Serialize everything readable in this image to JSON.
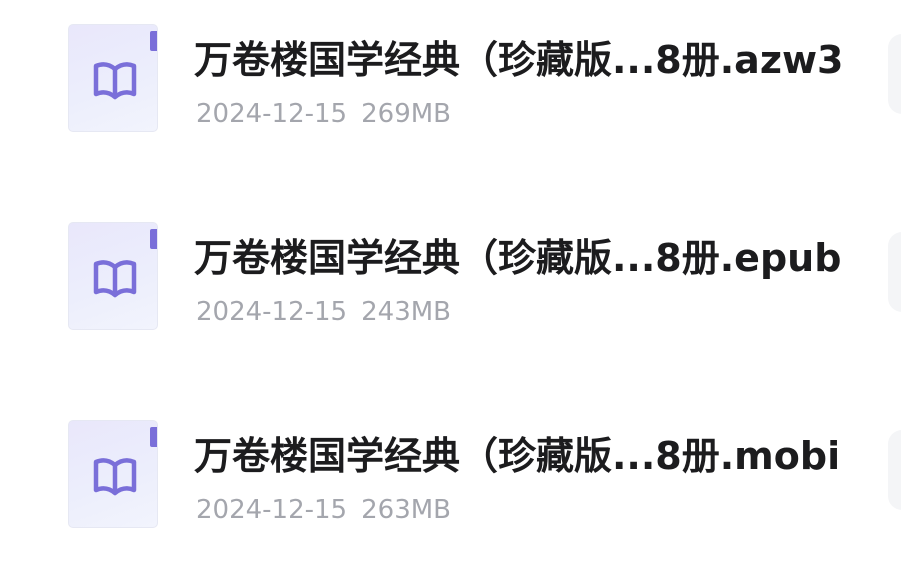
{
  "files": [
    {
      "name": "万卷楼国学经典（珍藏版...8册.azw3",
      "date": "2024-12-15",
      "size": "269MB",
      "icon": "ebook-icon"
    },
    {
      "name": "万卷楼国学经典（珍藏版...8册.epub",
      "date": "2024-12-15",
      "size": "243MB",
      "icon": "ebook-icon"
    },
    {
      "name": "万卷楼国学经典（珍藏版...8册.mobi",
      "date": "2024-12-15",
      "size": "263MB",
      "icon": "ebook-icon"
    }
  ],
  "colors": {
    "accent": "#7a6fd9",
    "title": "#1c1c1e",
    "meta": "#a4a6ad",
    "icon_bg": "#eceefc"
  }
}
